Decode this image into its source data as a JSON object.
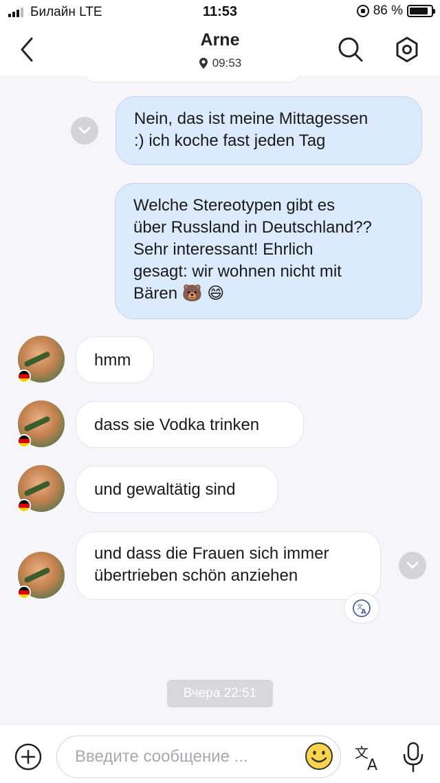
{
  "status_bar": {
    "carrier": "Билайн  LTE",
    "time": "11:53",
    "battery": "86 %",
    "battery_level": 0.86
  },
  "header": {
    "title": "Arne",
    "subtitle": "09:53",
    "icons": {
      "back": "back-chevron-icon",
      "location": "location-pin-icon",
      "search": "search-icon",
      "settings": "settings-icon"
    }
  },
  "messages": [
    {
      "direction": "out",
      "text": "Nein, das ist meine Mittagessen\n:) ich koche fast jeden Tag"
    },
    {
      "direction": "out",
      "text": "Welche Stereotypen gibt es\nüber Russland in Deutschland??\nSehr interessant! Ehrlich\ngesagt: wir wohnen nicht mit\nBären 🐻  😄"
    },
    {
      "direction": "in",
      "text": "hmm"
    },
    {
      "direction": "in",
      "text": "dass sie Vodka trinken"
    },
    {
      "direction": "in",
      "text": "und gewaltätig sind"
    },
    {
      "direction": "in",
      "text": "und dass die Frauen sich immer\nübertrieben schön anziehen"
    }
  ],
  "date_separator": "Вчера 22:51",
  "composer": {
    "placeholder": "Введите сообщение ...",
    "icons": {
      "plus": "plus-circle-icon",
      "emoji": "emoji-smile-icon",
      "translate": "translate-icon",
      "mic": "microphone-icon"
    }
  },
  "colors": {
    "outgoing_bubble": "#dbeafd",
    "incoming_bubble": "#ffffff",
    "background": "#f6f5f9",
    "flag_black": "#000000",
    "flag_red": "#dd0000",
    "flag_gold": "#ffce00"
  }
}
